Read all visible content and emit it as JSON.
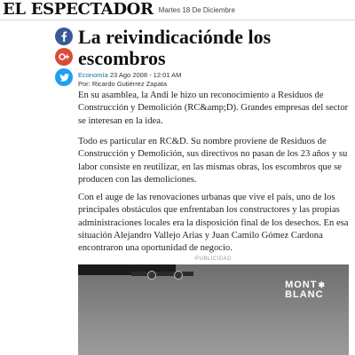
{
  "header": {
    "logo": "EL ESPECTADOR",
    "date": "Martes 18 De Diciembre"
  },
  "share": {
    "icons": [
      "facebook-icon",
      "google-plus-icon",
      "twitter-icon"
    ],
    "colors": {
      "facebook": "#3b5998",
      "google_plus": "#dd4b39",
      "twitter": "#1da1f2"
    }
  },
  "article": {
    "title": "La reivindicaciónde los escombros",
    "section": "Economía",
    "datetime": "23 Ago 2008 - 12:01 AM",
    "byline": "Por: Ricardo Gutiérrez Zapata",
    "paragraphs": [
      "En su asamblea, la Andi le hizo un reconocimiento a Residuos de Construcción y Demolición (RC&amp;D). Grandes empresas del sector se interesan en la idea.",
      "Todo es particular en RC&D. Su nombre proviene de Residuos de Construcción y Demolición, sus directivos no pasan de los 23 años y su labor consiste en reutilizar, en las mismas obras, los escombros que se producen con las demoliciones.",
      "Con el auge de las renovaciones urbanas que vive el país, uno de los principales obstáculos que enfrentaban los constructores y las propias administraciones locales era la disposición final de los desechos. En esa situación Alejandro Vallejo Arias y Juan Camilo Gómez Cardona encontraron una oportunidad de negocio."
    ]
  },
  "ad": {
    "label": "PUBLICIDAD",
    "brand_line1": "MONT",
    "brand_line2": "BLANC"
  }
}
